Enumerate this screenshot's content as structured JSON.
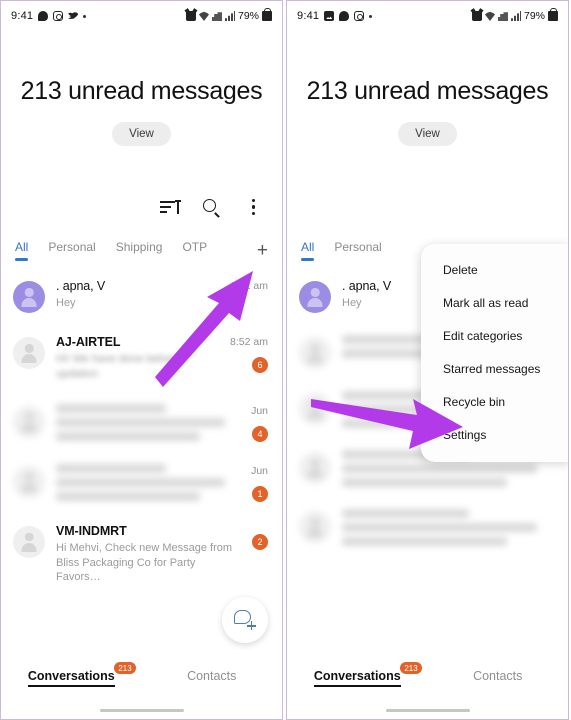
{
  "app": {
    "accent_blue": "#2f77c9",
    "badge_orange": "#e2622a",
    "avatar_purple": "#9b8ce4",
    "arrow_purple": "#b23ae8"
  },
  "left": {
    "statusbar": {
      "time": "9:41",
      "left_icons": [
        "messenger-icon",
        "instagram-icon",
        "twitter-icon",
        "dot-icon"
      ],
      "right_icons": [
        "alarm-icon",
        "wifi-icon",
        "network-icon",
        "signal-icon"
      ],
      "battery": "79%"
    },
    "header": {
      "title": "213 unread messages",
      "view_label": "View"
    },
    "toolbar": {
      "sort_icon": "sort-icon",
      "search_icon": "search-icon",
      "more_icon": "more-options-icon"
    },
    "tabs": {
      "items": [
        {
          "label": "All",
          "active": true
        },
        {
          "label": "Personal",
          "active": false
        },
        {
          "label": "Shipping",
          "active": false
        },
        {
          "label": "OTP",
          "active": false
        }
      ],
      "add_label": "+"
    },
    "conversations": [
      {
        "name": ". apna, V",
        "preview": "Hey",
        "time": "9:11 am",
        "badge": "",
        "avatar": "purple",
        "blurred": false
      },
      {
        "name": "AJ-AIRTEL",
        "preview": "Hi! We have done below updation",
        "time": "8:52 am",
        "badge": "6",
        "avatar": "gray",
        "blurred": false
      },
      {
        "name": "",
        "preview": "",
        "time": "Jun",
        "badge": "4",
        "avatar": "gray",
        "blurred": true
      },
      {
        "name": "",
        "preview": "",
        "time": "Jun",
        "badge": "1",
        "avatar": "gray",
        "blurred": true
      },
      {
        "name": "VM-INDMRT",
        "preview": "Hi Mehvi, Check new Message from Bliss Packaging Co for Party Favors…",
        "time": "",
        "badge": "2",
        "avatar": "gray",
        "blurred": false
      }
    ],
    "fab": {
      "icon": "new-conversation-icon"
    },
    "bottomnav": {
      "items": [
        {
          "label": "Conversations",
          "badge": "213",
          "active": true
        },
        {
          "label": "Contacts",
          "badge": "",
          "active": false
        }
      ]
    },
    "annotation": {
      "arrow": "arrow-to-more-options"
    }
  },
  "right": {
    "statusbar": {
      "time": "9:41",
      "left_icons": [
        "image-icon",
        "messenger-icon",
        "instagram-icon",
        "dot-icon"
      ],
      "right_icons": [
        "alarm-icon",
        "wifi-icon",
        "network-icon",
        "signal-icon"
      ],
      "battery": "79%"
    },
    "header": {
      "title": "213 unread messages",
      "view_label": "View"
    },
    "tabs": {
      "items": [
        {
          "label": "All",
          "active": true
        },
        {
          "label": "Personal",
          "active": false
        }
      ]
    },
    "conversations": [
      {
        "name": ". apna, V",
        "preview": "Hey",
        "avatar": "purple",
        "blurred": false
      },
      {
        "name": "",
        "preview": "",
        "avatar": "gray",
        "blurred": true
      },
      {
        "name": "",
        "preview": "",
        "avatar": "gray",
        "blurred": true
      },
      {
        "name": "",
        "preview": "",
        "avatar": "gray",
        "blurred": true
      },
      {
        "name": "",
        "preview": "",
        "avatar": "gray",
        "blurred": true
      }
    ],
    "menu": {
      "items": [
        {
          "label": "Delete"
        },
        {
          "label": "Mark all as read"
        },
        {
          "label": "Edit categories"
        },
        {
          "label": "Starred messages"
        },
        {
          "label": "Recycle bin"
        },
        {
          "label": "Settings"
        }
      ]
    },
    "bottomnav": {
      "items": [
        {
          "label": "Conversations",
          "badge": "213",
          "active": true
        },
        {
          "label": "Contacts",
          "badge": "",
          "active": false
        }
      ]
    },
    "annotation": {
      "arrow": "arrow-to-recycle-bin"
    }
  }
}
